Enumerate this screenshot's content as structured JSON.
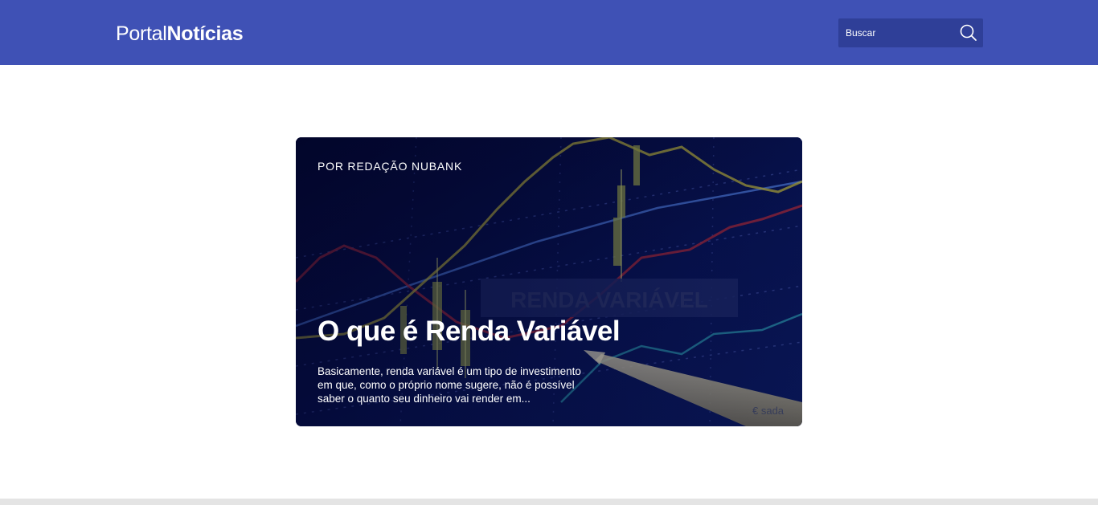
{
  "header": {
    "logo_light": "Portal",
    "logo_bold": "Notícias",
    "search_placeholder": "Buscar",
    "search_icon": "search-icon"
  },
  "featured_article": {
    "author": "POR REDAÇÃO NUBANK",
    "title": "O que é Renda Variável",
    "excerpt": "Basicamente, renda variável é um tipo de investimento em que, como o próprio nome sugere, não é possível saber o quanto seu dinheiro vai render em...",
    "image_caption": "RENDA VARIÁVEL"
  },
  "colors": {
    "header_bg": "#3f51b5",
    "search_bg": "#2f3f98",
    "card_bg": "#050a3a",
    "footer_strip": "#e4e4e4"
  }
}
